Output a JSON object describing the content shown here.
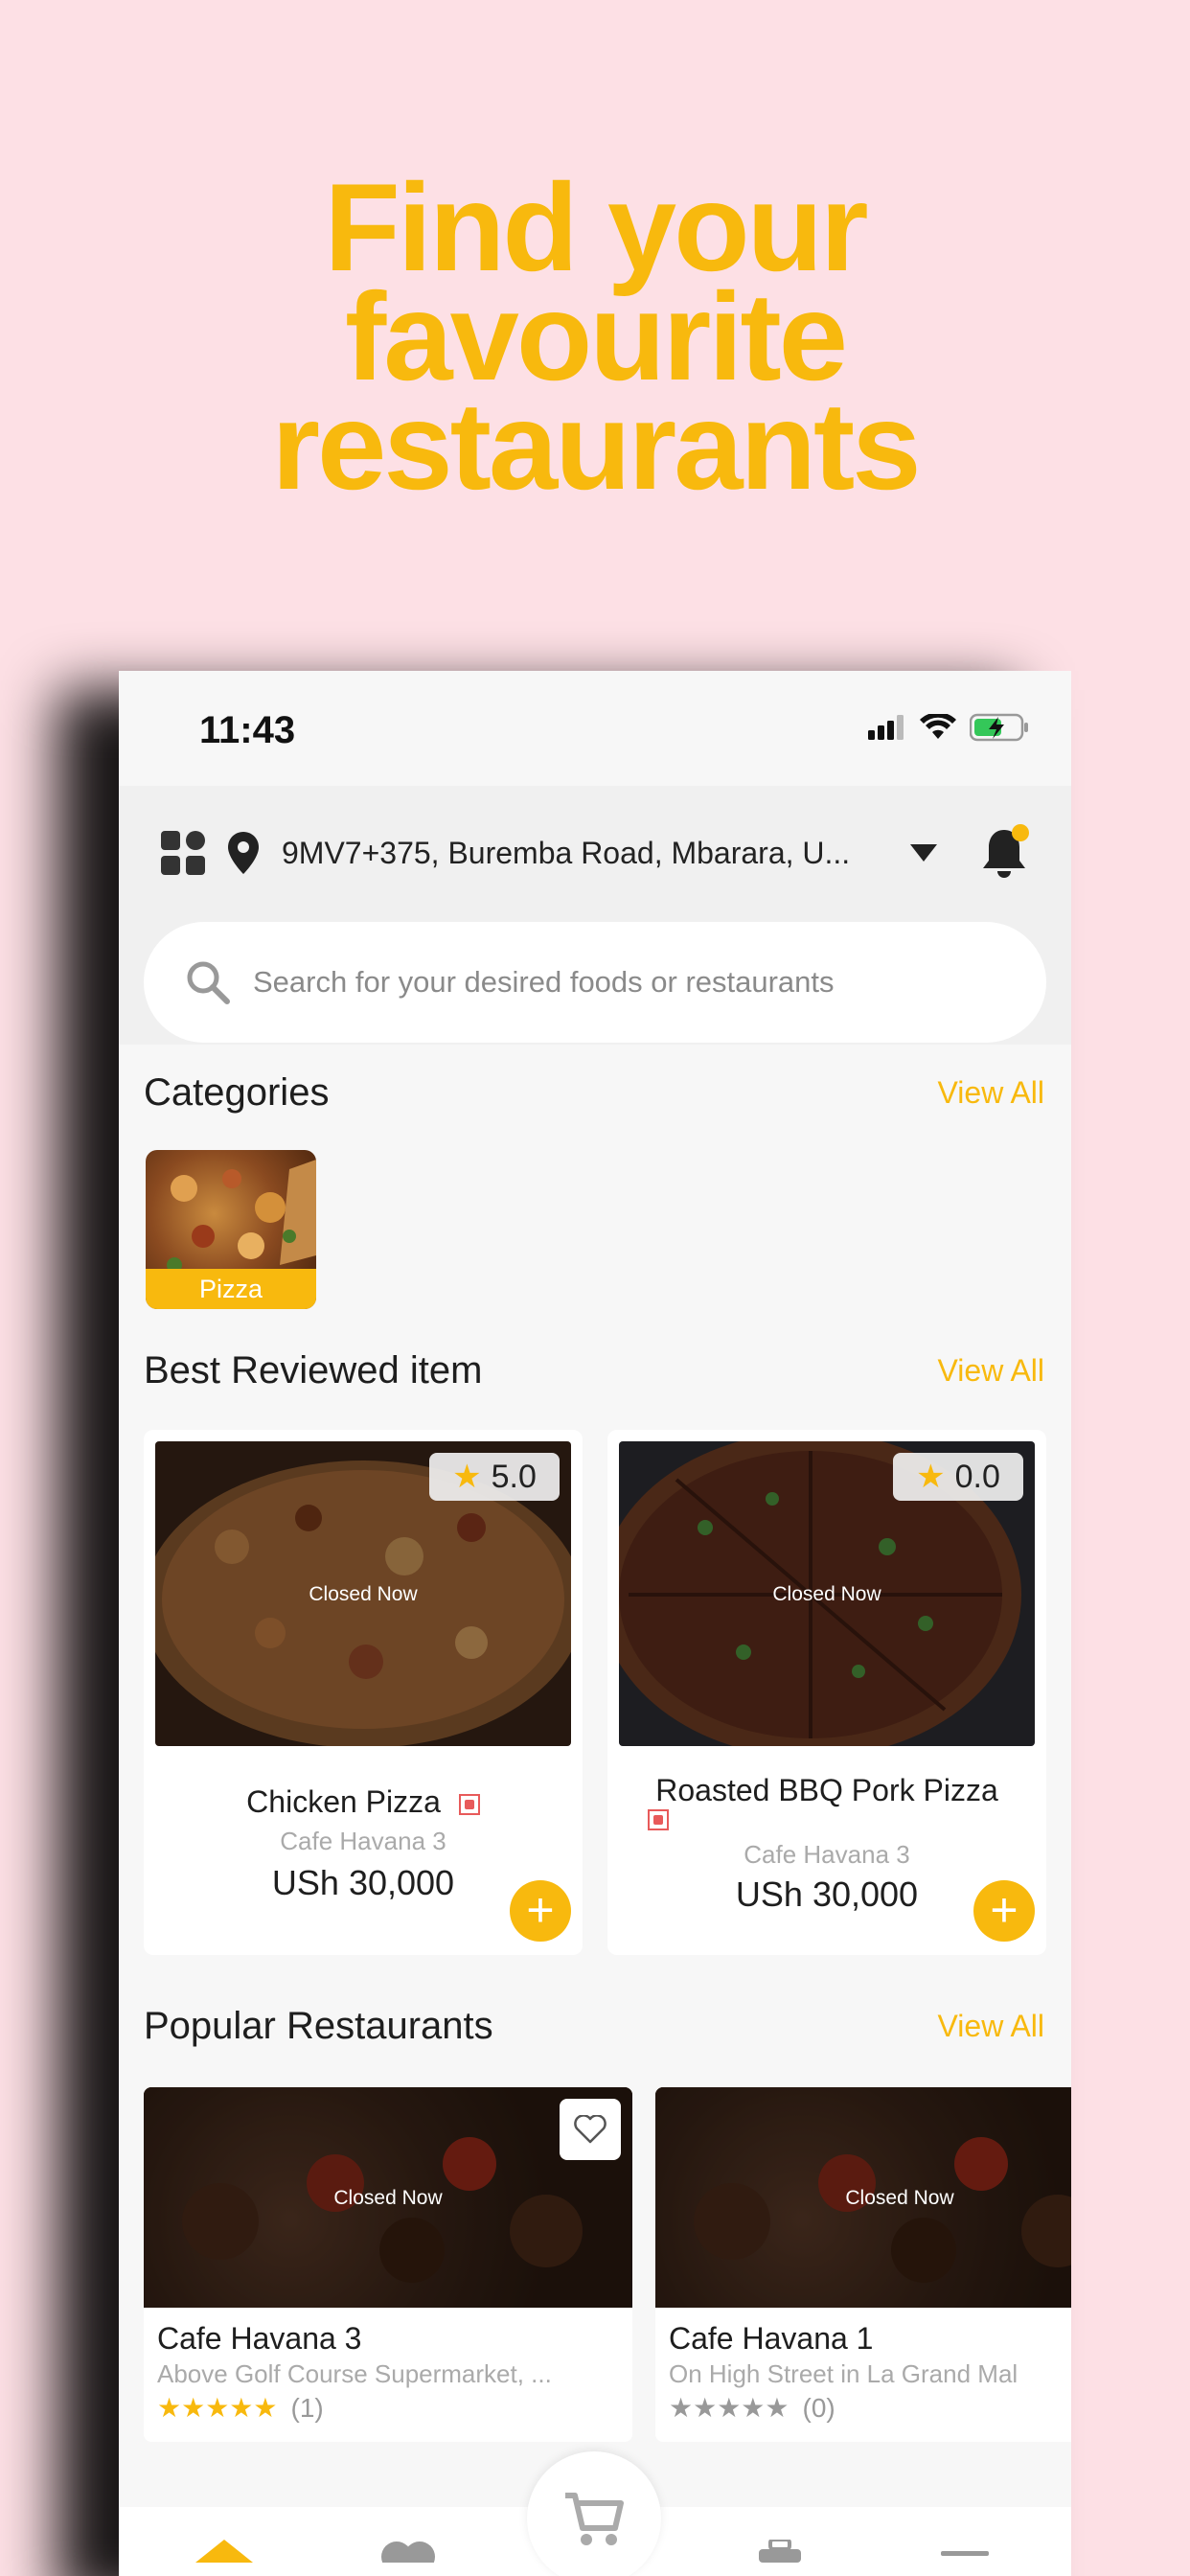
{
  "headline": [
    "Find your",
    "favourite",
    "restaurants"
  ],
  "status_bar": {
    "time": "11:43"
  },
  "location": {
    "address": "9MV7+375, Buremba Road, Mbarara, U..."
  },
  "search": {
    "placeholder": "Search for your desired foods or restaurants"
  },
  "categories": {
    "title": "Categories",
    "view_all": "View All",
    "items": [
      {
        "label": "Pizza"
      }
    ]
  },
  "best_reviewed": {
    "title": "Best Reviewed item",
    "view_all": "View All",
    "items": [
      {
        "name": "Chicken Pizza",
        "restaurant": "Cafe Havana 3",
        "price": "USh 30,000",
        "rating": "5.0",
        "status": "Closed Now"
      },
      {
        "name": "Roasted BBQ Pork Pizza",
        "restaurant": "Cafe Havana 3",
        "price": "USh 30,000",
        "rating": "0.0",
        "status": "Closed Now"
      }
    ]
  },
  "popular_restaurants": {
    "title": "Popular Restaurants",
    "view_all": "View All",
    "items": [
      {
        "name": "Cafe Havana 3",
        "address": "Above Golf Course Supermarket, ...",
        "reviews": "(1)",
        "stars": 5,
        "status": "Closed Now"
      },
      {
        "name": "Cafe Havana 1",
        "address": "On High Street in La Grand Mal",
        "reviews": "(0)",
        "stars": 0,
        "status": "Closed Now"
      }
    ]
  },
  "colors": {
    "accent": "#f8b90e",
    "background": "#fde0e5"
  }
}
